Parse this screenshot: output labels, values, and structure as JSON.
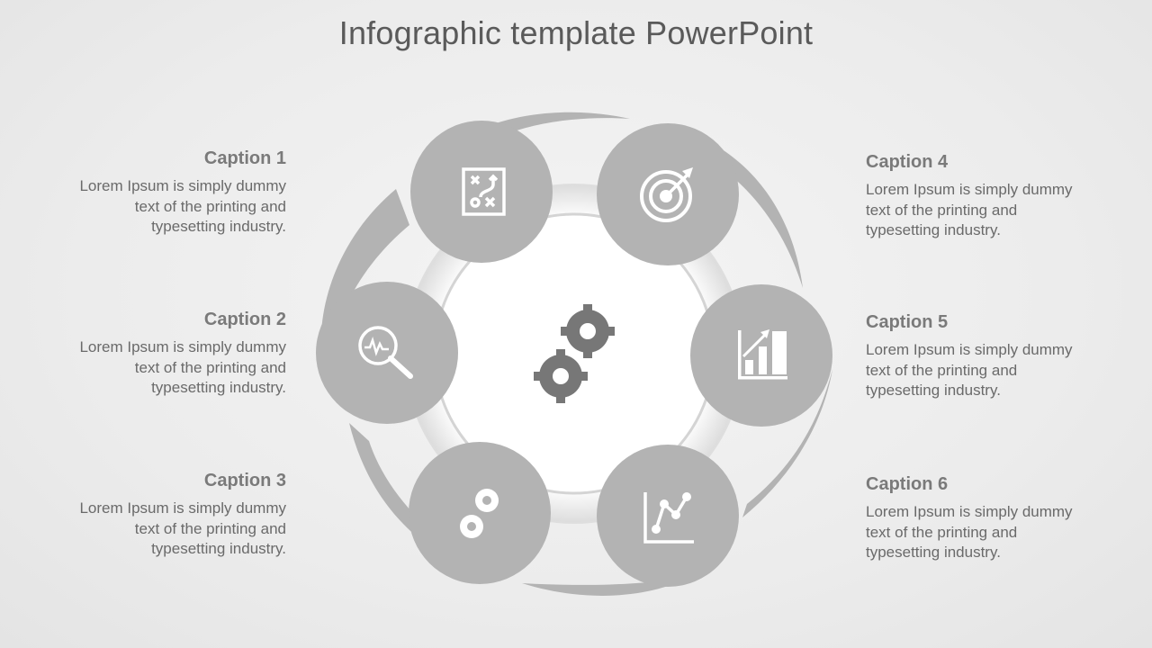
{
  "title": "Infographic template PowerPoint",
  "colors": {
    "circle_fill": "#b3b3b3",
    "swoosh_fill": "#b3b3b3",
    "center_fill": "#ffffff",
    "center_gears": "#777777",
    "text_caption": "#7a7a7a",
    "text_body": "#6a6a6a"
  },
  "center": {
    "icon": "gears-icon"
  },
  "steps": [
    {
      "caption": "Caption 1",
      "body": "Lorem Ipsum is simply dummy text of the printing and typesetting industry.",
      "icon": "strategy-plan-icon"
    },
    {
      "caption": "Caption 2",
      "body": "Lorem Ipsum is simply dummy text of the printing and typesetting industry.",
      "icon": "analysis-magnifier-icon"
    },
    {
      "caption": "Caption 3",
      "body": "Lorem Ipsum is simply dummy text of the printing and typesetting industry.",
      "icon": "gears-icon"
    },
    {
      "caption": "Caption 4",
      "body": "Lorem Ipsum is simply dummy text of the printing and typesetting industry.",
      "icon": "target-icon"
    },
    {
      "caption": "Caption 5",
      "body": "Lorem Ipsum is simply dummy text of the printing and typesetting industry.",
      "icon": "bar-chart-growth-icon"
    },
    {
      "caption": "Caption 6",
      "body": "Lorem Ipsum is simply dummy text of the printing and typesetting industry.",
      "icon": "line-chart-icon"
    }
  ]
}
